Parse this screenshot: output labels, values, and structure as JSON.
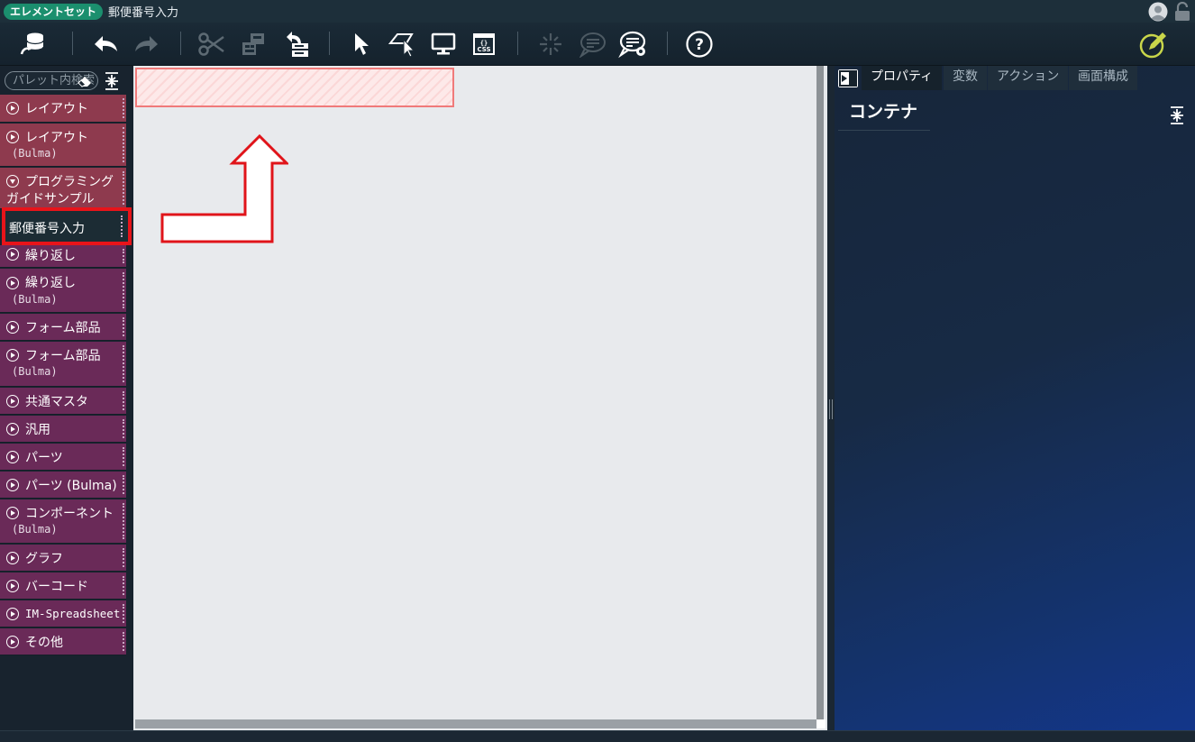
{
  "titlebar": {
    "badge": "エレメントセット",
    "title": "郵便番号入力"
  },
  "toolbar": {
    "buttons": [
      "database-icon",
      "undo-icon",
      "redo-icon",
      "cut-icon",
      "copy-icon",
      "paste-tree-icon",
      "select-pointer-icon",
      "move-pointer-icon",
      "preview-monitor-icon",
      "css-icon",
      "sparkle-icon",
      "comment-icon",
      "comment-settings-icon",
      "help-icon",
      "edit-pen-icon"
    ]
  },
  "palette": {
    "search_placeholder": "パレット内検索",
    "items": [
      {
        "label": "レイアウト",
        "sub": ""
      },
      {
        "label": "レイアウト",
        "sub": "(Bulma)"
      },
      {
        "label": "プログラミング",
        "label2": "ガイドサンプル"
      },
      {
        "label": "郵便番号入力"
      },
      {
        "label": "繰り返し",
        "sub": ""
      },
      {
        "label": "繰り返し",
        "sub": "(Bulma)"
      },
      {
        "label": "フォーム部品",
        "sub": ""
      },
      {
        "label": "フォーム部品",
        "sub": "(Bulma)"
      },
      {
        "label": "共通マスタ"
      },
      {
        "label": "汎用"
      },
      {
        "label": "パーツ"
      },
      {
        "label": "パーツ (Bulma)"
      },
      {
        "label": "コンポーネント",
        "sub": "(Bulma)"
      },
      {
        "label": "グラフ"
      },
      {
        "label": "バーコード"
      },
      {
        "label": "IM-Spreadsheet"
      },
      {
        "label": "その他"
      }
    ]
  },
  "right_panel": {
    "tabs": [
      "プロパティ",
      "変数",
      "アクション",
      "画面構成"
    ],
    "active_tab": "プロパティ",
    "title": "コンテナ"
  },
  "colors": {
    "badge": "#1b8f6e",
    "palette_red": "#8e3a4e",
    "palette_purple": "#6a2a58",
    "highlight": "#e8141a",
    "drop_zone_border": "#f07a7a"
  }
}
